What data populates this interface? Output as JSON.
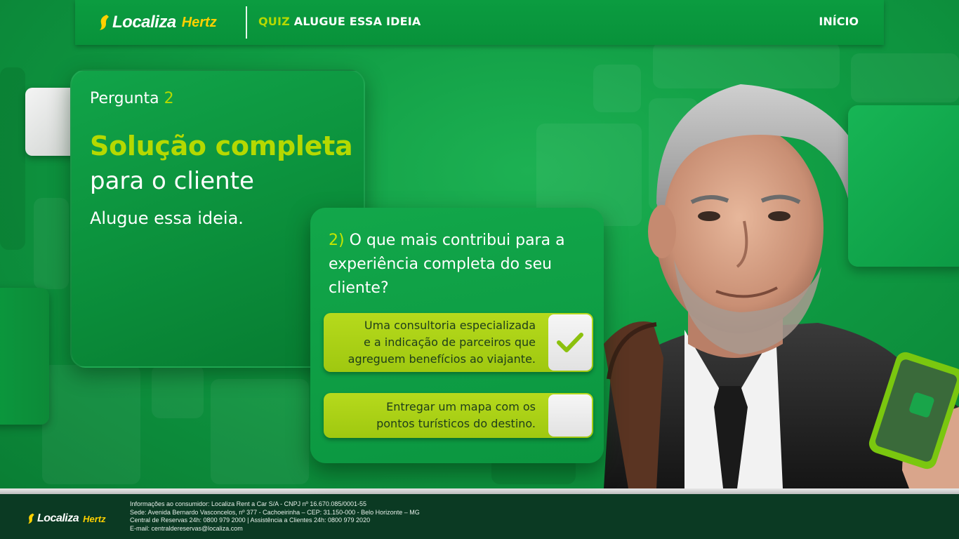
{
  "brand": {
    "name": "Localiza",
    "partner": "Hertz"
  },
  "header": {
    "nav_prefix": "QUIZ",
    "nav_title": "ALUGUE ESSA IDEIA",
    "home_label": "INÍCIO"
  },
  "intro": {
    "question_label": "Pergunta",
    "question_number": "2",
    "headline": "Solução completa",
    "headline_sub": "para o cliente",
    "tagline": "Alugue essa ideia."
  },
  "question": {
    "number": "2)",
    "text": "O que mais contribui para a experiência completa do seu cliente?",
    "options": [
      {
        "lines": [
          "Uma consultoria especializada",
          "e a indicação de parceiros que",
          "agreguem benefícios ao viajante."
        ],
        "checked": true
      },
      {
        "lines": [
          "Entregar um mapa com os",
          "pontos turísticos do destino."
        ],
        "checked": false
      }
    ]
  },
  "footer": {
    "lines": [
      "Informações ao consumidor: Localiza Rent a Car S/A - CNPJ nº 16.670.085/0001-55",
      "Sede: Avenida Bernardo Vasconcelos, nº 377 - Cachoeirinha – CEP: 31.150-000 - Belo Horizonte – MG",
      "Central de Reservas 24h: 0800 979 2000 | Assistência a Clientes 24h: 0800 979 2020",
      "E-mail: centraldereservas@localiza.com"
    ]
  },
  "colors": {
    "brand_green": "#0b9c40",
    "accent_lime": "#b5d900",
    "footer_bg": "#0b3a23",
    "logo_yellow": "#ffd100"
  },
  "icons": [
    "localiza-logo-icon",
    "check-icon"
  ]
}
